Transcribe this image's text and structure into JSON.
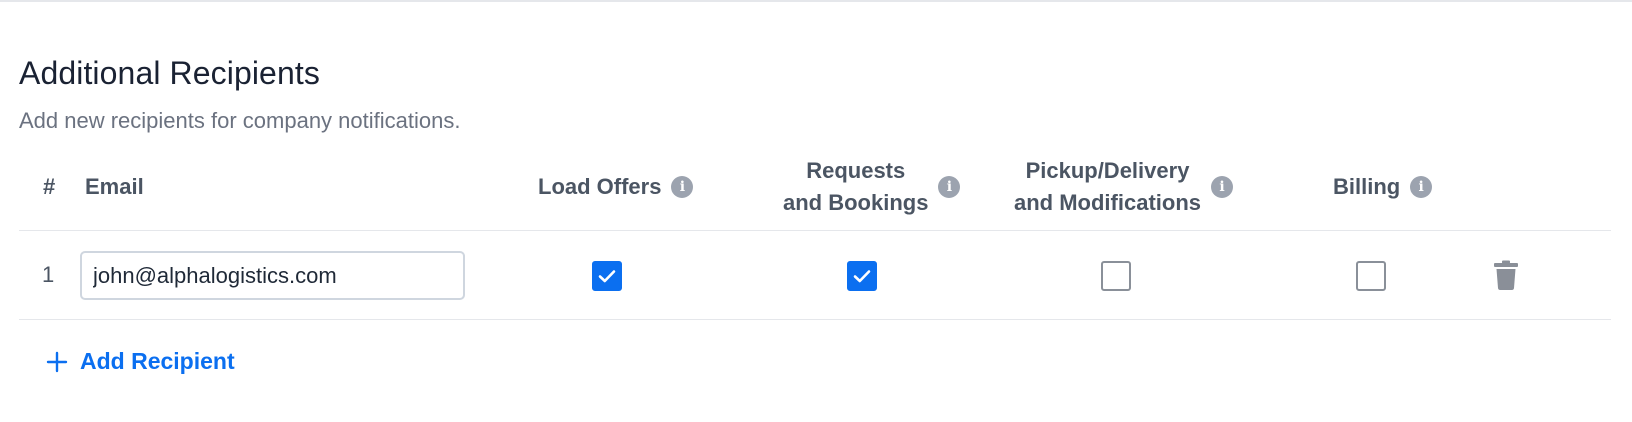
{
  "section": {
    "title": "Additional Recipients",
    "subtitle": "Add new recipients for company notifications."
  },
  "table": {
    "headers": {
      "number": "#",
      "email": "Email",
      "load_offers": "Load Offers",
      "requests_line1": "Requests",
      "requests_line2": "and Bookings",
      "pickup_line1": "Pickup/Delivery",
      "pickup_line2": "and Modifications",
      "billing": "Billing"
    },
    "rows": [
      {
        "number": "1",
        "email": "john@alphalogistics.com",
        "load_offers": true,
        "requests_and_bookings": true,
        "pickup_delivery_modifications": false,
        "billing": false
      }
    ]
  },
  "actions": {
    "add_recipient_label": "Add Recipient"
  },
  "icons": {
    "info": "info-icon",
    "delete": "trash-icon",
    "add": "plus-icon",
    "check": "checkmark-icon"
  },
  "colors": {
    "accent": "#0b6ff0",
    "icon_gray": "#9ca3af",
    "title": "#1a2233",
    "muted_text": "#6b7280"
  }
}
